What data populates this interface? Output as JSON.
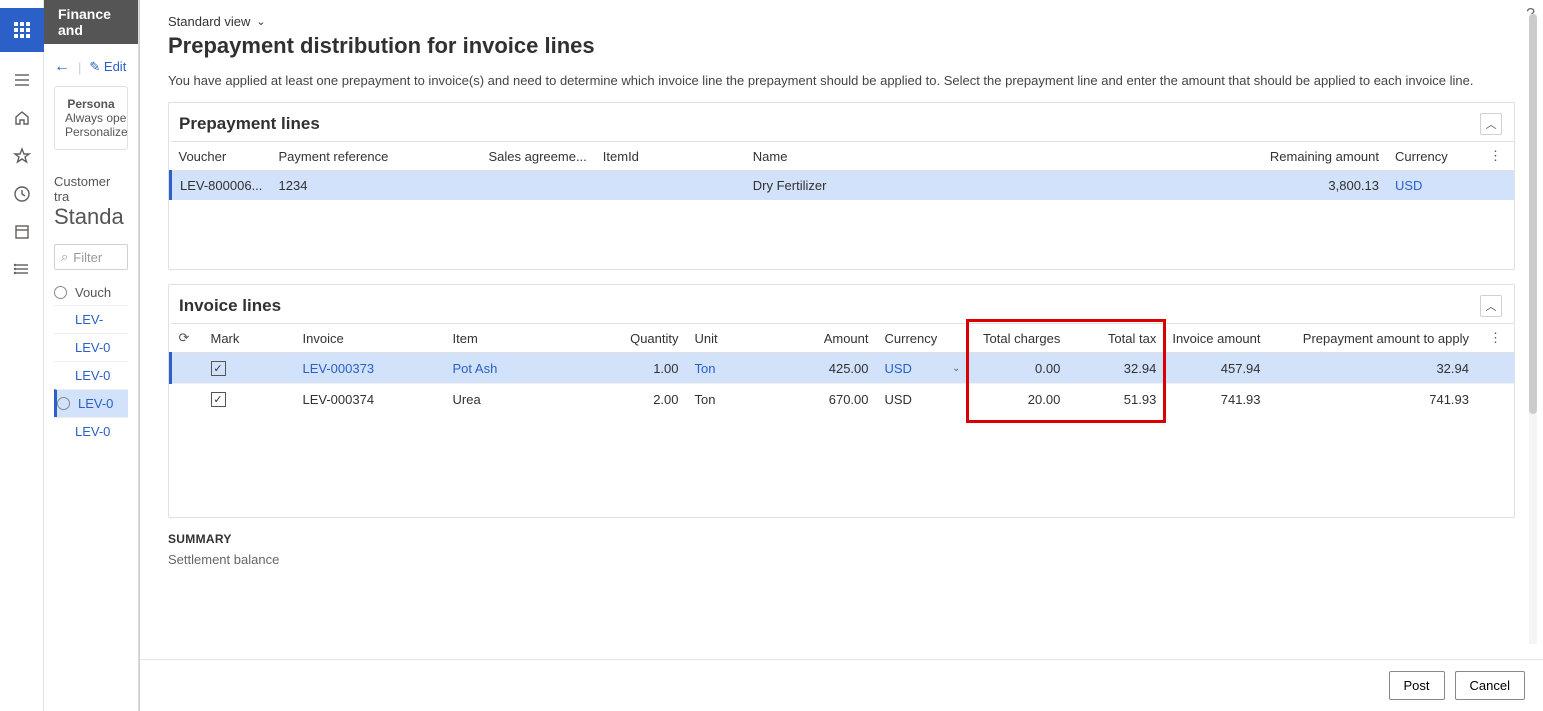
{
  "rail": {
    "title": "Finance and"
  },
  "bg": {
    "edit": "Edit",
    "card_title": "Persona",
    "card_line1": "Always open",
    "card_line2": "Personalize",
    "sub_label": "Customer tra",
    "sub_heading": "Standa",
    "filter_placeholder": "Filter",
    "list_header": "Vouch",
    "list_items": [
      "LEV-",
      "LEV-0",
      "LEV-0",
      "LEV-0",
      "LEV-0"
    ]
  },
  "dialog": {
    "view_label": "Standard view",
    "title": "Prepayment distribution for invoice lines",
    "description": "You have applied at least one prepayment to invoice(s) and need to determine which invoice line the prepayment should be applied to. Select the prepayment line and enter the amount that should be applied to each invoice line.",
    "section_prepay": {
      "title": "Prepayment lines",
      "cols": [
        "Voucher",
        "Payment reference",
        "Sales agreeme...",
        "ItemId",
        "Name",
        "Remaining amount",
        "Currency"
      ],
      "row": {
        "voucher": "LEV-800006...",
        "payref": "1234",
        "agreement": "",
        "itemid": "",
        "name": "Dry Fertilizer",
        "remaining": "3,800.13",
        "ccy": "USD"
      }
    },
    "section_inv": {
      "title": "Invoice lines",
      "cols": [
        "Mark",
        "Invoice",
        "Item",
        "Quantity",
        "Unit",
        "Amount",
        "Currency",
        "Total charges",
        "Total tax",
        "Invoice amount",
        "Prepayment amount to apply"
      ],
      "rows": [
        {
          "mark": true,
          "invoice": "LEV-000373",
          "item": "Pot Ash",
          "qty": "1.00",
          "unit": "Ton",
          "amount": "425.00",
          "ccy": "USD",
          "charges": "0.00",
          "tax": "32.94",
          "invamt": "457.94",
          "prepay": "32.94",
          "sel": true
        },
        {
          "mark": true,
          "invoice": "LEV-000374",
          "item": "Urea",
          "qty": "2.00",
          "unit": "Ton",
          "amount": "670.00",
          "ccy": "USD",
          "charges": "20.00",
          "tax": "51.93",
          "invamt": "741.93",
          "prepay": "741.93",
          "sel": false
        }
      ]
    },
    "summary": {
      "title": "SUMMARY",
      "line1": "Settlement balance"
    },
    "buttons": {
      "post": "Post",
      "cancel": "Cancel"
    }
  }
}
